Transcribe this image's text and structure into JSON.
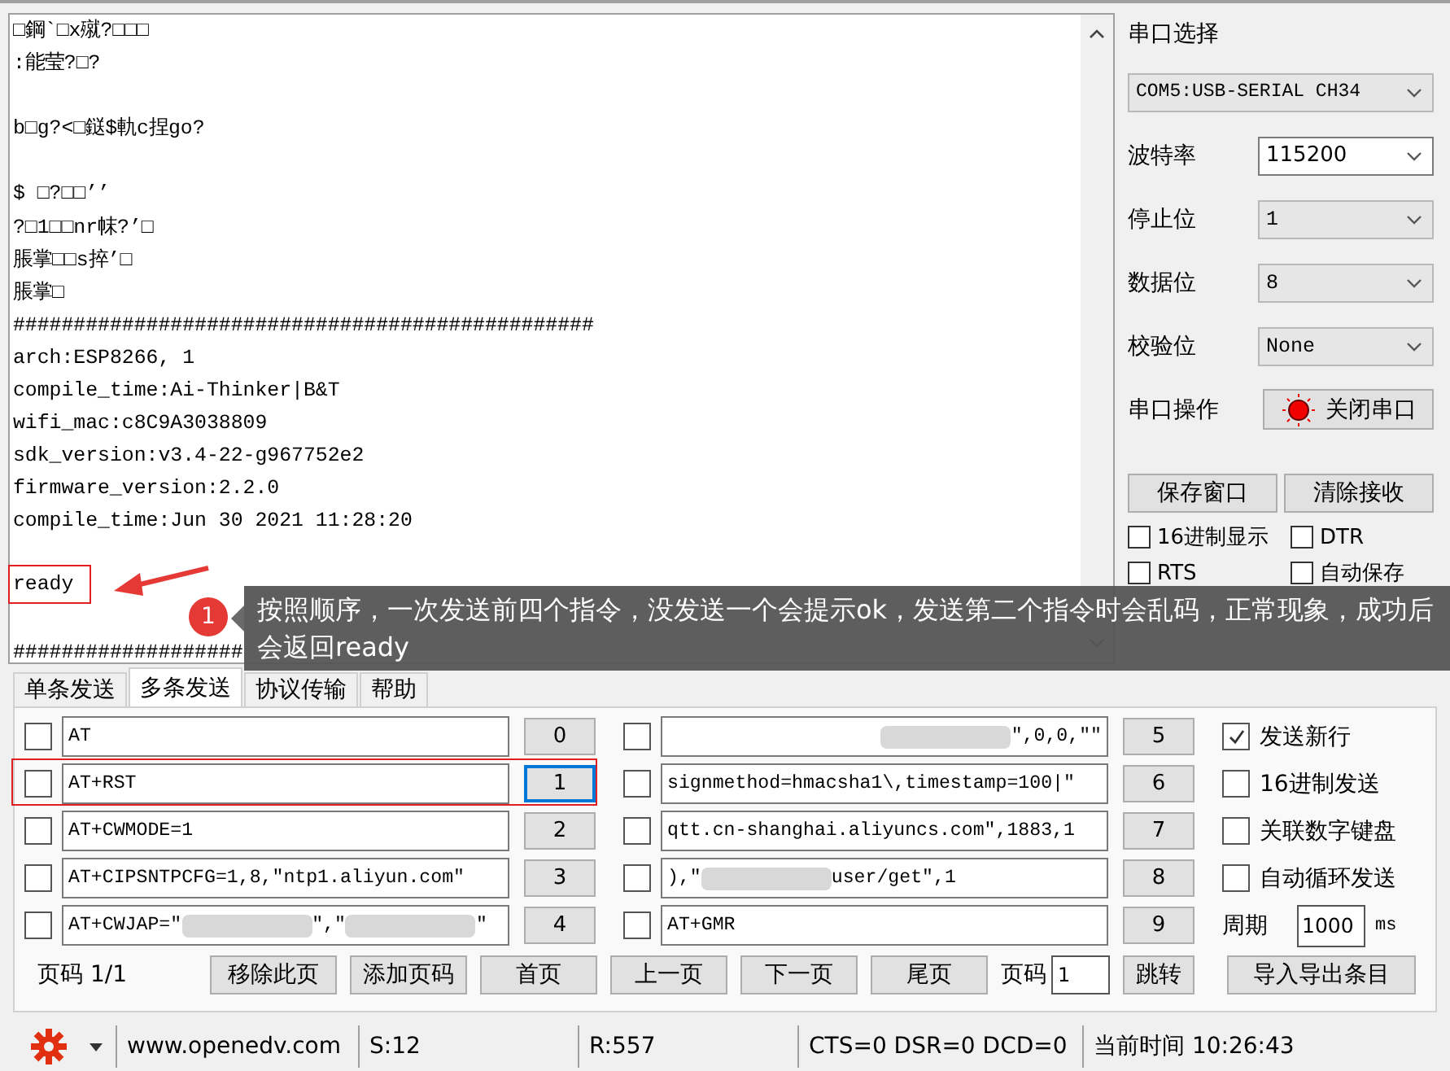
{
  "terminal": {
    "lines": [
      {
        "text": "□鋼`□x殧?□□□",
        "gap_before": false,
        "highlighted": false
      },
      {
        "text": ":能莹?□?",
        "gap_before": false,
        "highlighted": false
      },
      {
        "text": "b□g?<□鎹$軌c捏go?",
        "gap_before": true,
        "highlighted": false
      },
      {
        "text": "$ □?□□’’",
        "gap_before": true,
        "highlighted": false
      },
      {
        "text": "?□1□□nr帓?’□",
        "gap_before": false,
        "highlighted": false
      },
      {
        "text": "脹掌□□s捽’□",
        "gap_before": false,
        "highlighted": false
      },
      {
        "text": "脹掌□",
        "gap_before": false,
        "highlighted": false
      },
      {
        "text": "################################################",
        "gap_before": false,
        "highlighted": false
      },
      {
        "text": "arch:ESP8266, 1",
        "gap_before": false,
        "highlighted": false
      },
      {
        "text": "compile_time:Ai-Thinker|B&T",
        "gap_before": false,
        "highlighted": false
      },
      {
        "text": "wifi_mac:c8C9A3038809",
        "gap_before": false,
        "highlighted": false
      },
      {
        "text": "sdk_version:v3.4-22-g967752e2",
        "gap_before": false,
        "highlighted": false
      },
      {
        "text": "firmware_version:2.2.0",
        "gap_before": false,
        "highlighted": false
      },
      {
        "text": "compile_time:Jun 30 2021 11:28:20",
        "gap_before": false,
        "highlighted": false
      },
      {
        "text": "ready",
        "gap_before": true,
        "highlighted": true
      },
      {
        "text": "###################",
        "gap_before": true,
        "highlighted": false
      }
    ]
  },
  "serial_settings": [
    {
      "label": "串口选择",
      "kind": "wide-select",
      "value": "COM5:USB-SERIAL CH34"
    },
    {
      "label": "波特率",
      "kind": "combo",
      "value": "115200"
    },
    {
      "label": "停止位",
      "kind": "select",
      "value": "1"
    },
    {
      "label": "数据位",
      "kind": "select",
      "value": "8"
    },
    {
      "label": "校验位",
      "kind": "select",
      "value": "None"
    },
    {
      "label": "串口操作",
      "kind": "port-button",
      "value": "关闭串口",
      "port_open": true
    }
  ],
  "receive_buttons": [
    "保存窗口",
    "清除接收"
  ],
  "receive_options": [
    {
      "label": "16进制显示",
      "checked": false
    },
    {
      "label": "DTR",
      "checked": false
    },
    {
      "label": "RTS",
      "checked": false
    },
    {
      "label": "自动保存",
      "checked": false
    }
  ],
  "tabs": [
    {
      "label": "单条发送",
      "selected": false
    },
    {
      "label": "多条发送",
      "selected": true
    },
    {
      "label": "协议传输",
      "selected": false
    },
    {
      "label": "帮助",
      "selected": false
    }
  ],
  "commands": [
    {
      "checked": false,
      "highlighted": false,
      "button": "0",
      "parts": [
        {
          "kind": "text",
          "text": "AT"
        }
      ]
    },
    {
      "checked": false,
      "highlighted": true,
      "button": "1",
      "parts": [
        {
          "kind": "text",
          "text": "AT+RST"
        }
      ]
    },
    {
      "checked": false,
      "highlighted": false,
      "button": "2",
      "parts": [
        {
          "kind": "text",
          "text": "AT+CWMODE=1"
        }
      ]
    },
    {
      "checked": false,
      "highlighted": false,
      "button": "3",
      "parts": [
        {
          "kind": "text",
          "text": "AT+CIPSNTPCFG=1,8,\"ntp1.aliyun.com\""
        }
      ]
    },
    {
      "checked": false,
      "highlighted": false,
      "button": "4",
      "parts": [
        {
          "kind": "text",
          "text": "AT+CWJAP=\""
        },
        {
          "kind": "redacted"
        },
        {
          "kind": "text",
          "text": "\",\""
        },
        {
          "kind": "redacted"
        },
        {
          "kind": "text",
          "text": "\""
        }
      ]
    },
    {
      "checked": false,
      "highlighted": false,
      "button": "5",
      "parts": [
        {
          "kind": "redacted"
        },
        {
          "kind": "text",
          "text": "\",0,0,\"\""
        }
      ]
    },
    {
      "checked": false,
      "highlighted": false,
      "button": "6",
      "parts": [
        {
          "kind": "text",
          "text": "signmethod=hmacsha1\\,timestamp=100|\""
        }
      ]
    },
    {
      "checked": false,
      "highlighted": false,
      "button": "7",
      "parts": [
        {
          "kind": "text",
          "text": "qtt.cn-shanghai.aliyuncs.com\",1883,1"
        }
      ]
    },
    {
      "checked": false,
      "highlighted": false,
      "button": "8",
      "parts": [
        {
          "kind": "text",
          "text": "),\""
        },
        {
          "kind": "redacted"
        },
        {
          "kind": "text",
          "text": "user/get\",1"
        }
      ]
    },
    {
      "checked": false,
      "highlighted": false,
      "button": "9",
      "parts": [
        {
          "kind": "text",
          "text": "AT+GMR"
        }
      ]
    }
  ],
  "send_options": [
    {
      "kind": "checkbox",
      "label": "发送新行",
      "checked": true
    },
    {
      "kind": "checkbox",
      "label": "16进制发送",
      "checked": false
    },
    {
      "kind": "checkbox",
      "label": "关联数字键盘",
      "checked": false
    },
    {
      "kind": "checkbox",
      "label": "自动循环发送",
      "checked": false
    },
    {
      "kind": "period",
      "label": "周期",
      "value": "1000",
      "unit": "ms"
    }
  ],
  "pager": {
    "page_label": "页码 1/1",
    "buttons": [
      "移除此页",
      "添加页码",
      "首页",
      "上一页",
      "下一页",
      "尾页"
    ],
    "goto_label": "页码",
    "goto_value": "1",
    "goto_button": "跳转",
    "import_button": "导入导出条目"
  },
  "status_bar": {
    "website": "www.openedv.com",
    "sent": "S:12",
    "received": "R:557",
    "lines": "CTS=0 DSR=0 DCD=0",
    "time": "当前时间 10:26:43"
  },
  "annotation": {
    "badge": "1",
    "note": "按照顺序，一次发送前四个指令，没发送一个会提示ok，发送第二个指令时会乱码，正常现象，成功后会返回ready"
  }
}
